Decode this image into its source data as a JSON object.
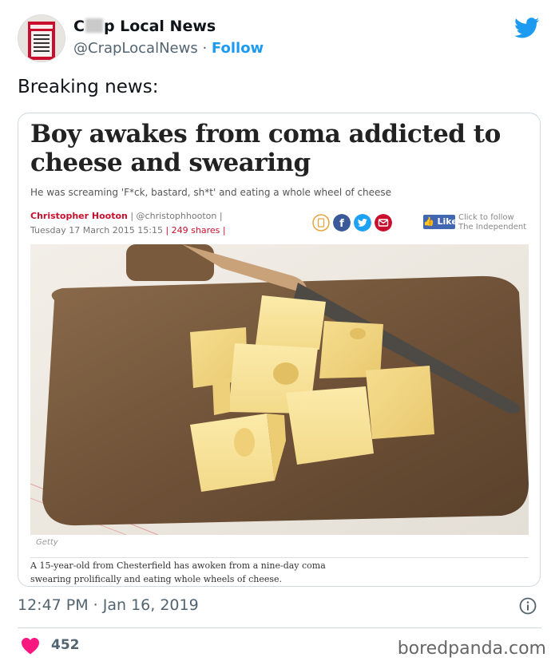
{
  "tweet": {
    "author_name_prefix": "C",
    "author_name_suffix": "p Local News",
    "handle": "@CrapLocalNews",
    "separator": "·",
    "follow_label": "Follow",
    "text": "Breaking news:",
    "timestamp": "12:47 PM · Jan 16, 2019",
    "like_count": "452"
  },
  "article": {
    "headline": "Boy awakes from coma addicted to cheese and swearing",
    "subheadline": "He was screaming 'F*ck, bastard, sh*t' and eating a whole wheel of cheese",
    "author": "Christopher Hooton",
    "author_handle": "| @christophhooton |",
    "date": "Tuesday 17 March 2015 15:15",
    "shares": "| 249 shares |",
    "like_label": "Like",
    "follow_text_line1": "Click to follow",
    "follow_text_line2": "The Independent",
    "photo_credit": "Getty",
    "caption": "A 15-year-old from Chesterfield has awoken from a nine-day coma swearing prolifically and eating whole wheels of cheese."
  },
  "footer": {
    "watermark": "boredpanda.com"
  },
  "colors": {
    "twitter_blue": "#1d9bf0",
    "heart_red": "#f91880",
    "independent_red": "#c8102e",
    "facebook_blue": "#3b5998",
    "twitter_circle": "#1da1f2"
  },
  "icons": {
    "brand": "twitter-bird-icon",
    "info": "info-icon",
    "like": "heart-icon",
    "bookmark": "bookmark-icon",
    "facebook": "facebook-icon",
    "twitter_share": "twitter-icon",
    "email": "email-icon"
  }
}
